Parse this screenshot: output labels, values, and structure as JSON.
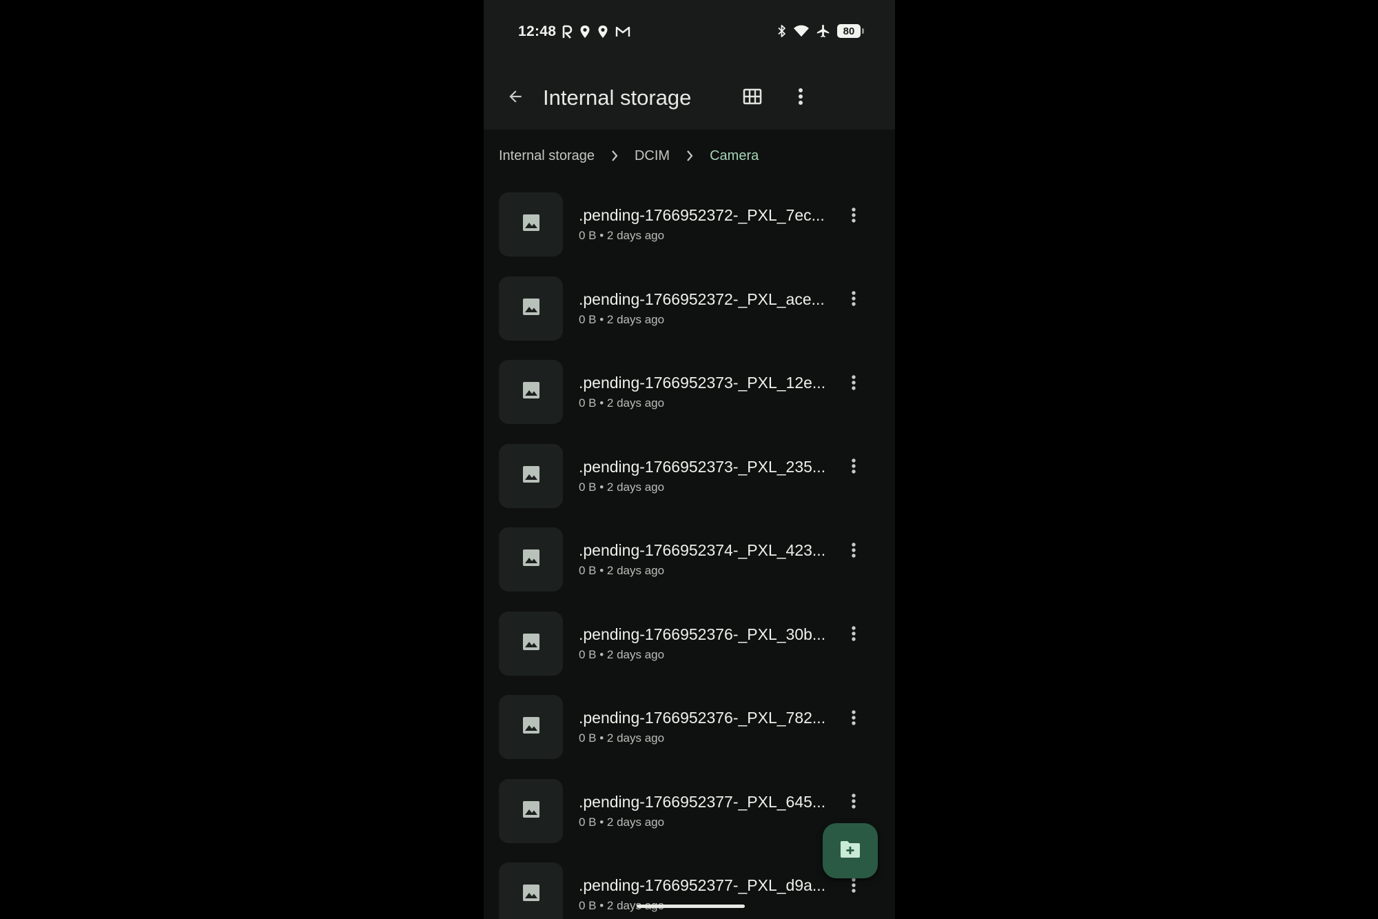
{
  "status_bar": {
    "time": "12:48",
    "left_icons": [
      "r-icon",
      "location-pin-icon",
      "location-pin-icon",
      "gmail-icon"
    ],
    "right_icons": [
      "bluetooth-icon",
      "wifi-icon",
      "airplane-icon"
    ],
    "battery": "80"
  },
  "app_bar": {
    "title": "Internal storage",
    "back_icon": "arrow-back-icon",
    "grid_icon": "grid-view-icon",
    "more_icon": "more-vert-icon"
  },
  "breadcrumb": {
    "items": [
      "Internal storage",
      "DCIM",
      "Camera"
    ]
  },
  "files": [
    {
      "name": ".pending-1766952372-_PXL_7ec...",
      "meta": "0 B • 2 days ago"
    },
    {
      "name": ".pending-1766952372-_PXL_ace...",
      "meta": "0 B • 2 days ago"
    },
    {
      "name": ".pending-1766952373-_PXL_12e...",
      "meta": "0 B • 2 days ago"
    },
    {
      "name": ".pending-1766952373-_PXL_235...",
      "meta": "0 B • 2 days ago"
    },
    {
      "name": ".pending-1766952374-_PXL_423...",
      "meta": "0 B • 2 days ago"
    },
    {
      "name": ".pending-1766952376-_PXL_30b...",
      "meta": "0 B • 2 days ago"
    },
    {
      "name": ".pending-1766952376-_PXL_782...",
      "meta": "0 B • 2 days ago"
    },
    {
      "name": ".pending-1766952377-_PXL_645...",
      "meta": "0 B • 2 days ago"
    },
    {
      "name": ".pending-1766952377-_PXL_d9a...",
      "meta": "0 B • 2 days ago"
    }
  ],
  "fab": {
    "icon": "new-folder-icon"
  },
  "colors": {
    "background": "#0e1110",
    "app_bar": "#181b1a",
    "accent": "#a6d4b7",
    "fab": "#2a5a44"
  }
}
